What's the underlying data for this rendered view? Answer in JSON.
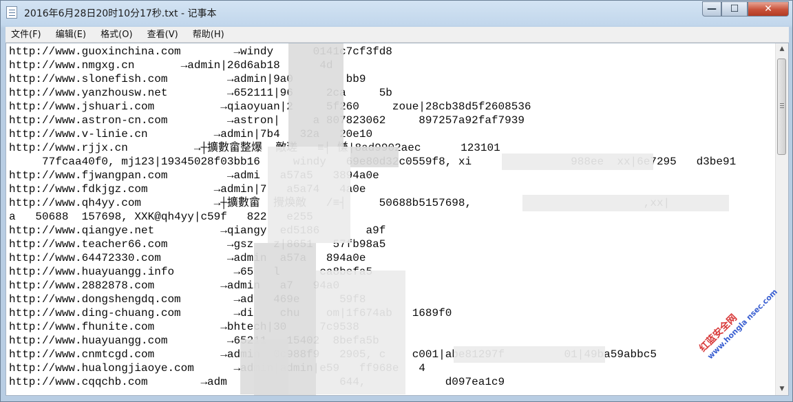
{
  "window": {
    "title": "2016年6月28日20时10分17秒.txt - 记事本",
    "min_glyph": "—",
    "max_glyph": "☐",
    "close_glyph": "✕"
  },
  "menu": [
    {
      "label": "文件(F)"
    },
    {
      "label": "编辑(E)"
    },
    {
      "label": "格式(O)"
    },
    {
      "label": "查看(V)"
    },
    {
      "label": "帮助(H)"
    }
  ],
  "lines": [
    "http://www.guoxinchina.com        →windy      0141c7cf3fd8",
    "http://www.nmgxg.cn       →admin|26d6ab18      4d",
    "http://www.slonefish.com         →admin|9a0        bb9",
    "http://www.yanzhousw.net         →652111|96     2ca     5b",
    "http://www.jshuari.com          →qiaoyuan|2     5f260     zoue|28cb38d5f2608536",
    "http://www.astron-cn.com         →astron|     a 807823062     897257a92faf7939",
    "http://www.v-linie.cn          →admin|7b4   32a   20e10",
    "http://www.rjjx.cn          →┼擴數畲整爆  敵瑳   ≡┤ 慊|8ad9902aec      123101",
    "     77fcaa40f0, mj123|19345028f03bb16     windy   69e80d32c0559f8, xi               988ee  xx|6e7295   d3be91",
    "http://www.fjwangpan.com         →admi   a57a5   3894a0e",
    "http://www.fdkjgz.com          →admin|7   a5a74   4a0e",
    "http://www.qh4yy.com           →┼擴數畲  攪煥敵   /≡┤     50688b5157698,                          ,xx|",
    "a   50688  157698, XXK@qh4yy|c59f   822   e255",
    "http://www.qiangye.net          →qiangy  ed5186       a9f",
    "http://www.teacher66.com         →gsz   z|8651   57fb98a5",
    "http://www.64472330.com          →admin  a57a   894a0e",
    "http://www.huayuangg.info         →65   l      ca8befa5",
    "http://www.2882878.com          →admin   a7   94a0",
    "http://www.dongshengdq.com        →ad   469e      59f8",
    "http://www.ding-chuang.com        →di    chu    om|1f674ab   1689f0",
    "http://www.fhunite.com          →bhtech|30     7c9538",
    "http://www.huayuangg.com         →65211   15402  8befa5b",
    "http://www.cnmtcgd.com          →admin  0c988f9   2905, c    c001|abe81297f         01|49ba59abbc5",
    "http://www.hualongjiaoye.com      →admin|admin|e59   ff968e   4",
    "http://www.cqqchb.com        →adm                 644,            d097ea1c9"
  ],
  "watermark": {
    "main": "红蓝安全网",
    "sub": "www.hongla nsec.com"
  },
  "colors": {
    "accent_close": "#c9523a",
    "watermark_red": "#d83b3b",
    "watermark_blue": "#3a5fd1"
  }
}
